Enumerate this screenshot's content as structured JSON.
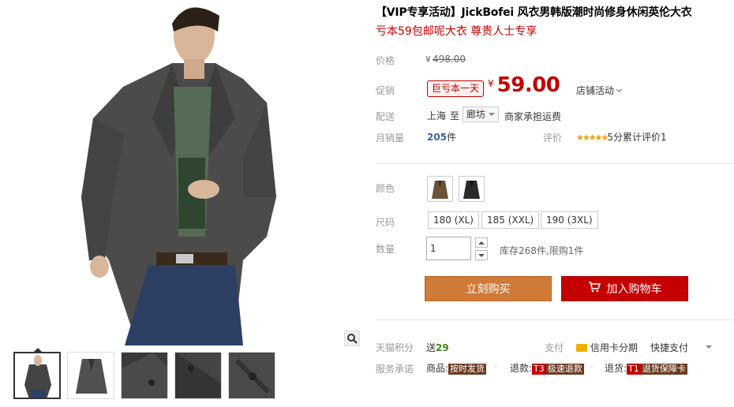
{
  "product": {
    "title": "【VIP专享活动】JickBofei 风衣男韩版潮时尚修身休闲英伦大衣",
    "subtitle": "亏本59包邮呢大衣 尊贵人士专享"
  },
  "price": {
    "label": "价格",
    "currency": "¥",
    "original": "498.00"
  },
  "promo": {
    "label": "促销",
    "tag": "巨亏本一天",
    "currency": "¥",
    "price": "59.00",
    "shop_activity": "店铺活动"
  },
  "shipping": {
    "label": "配送",
    "from": "上海",
    "to_label": "至",
    "destination": "廊坊",
    "fee_note": "商家承担运费"
  },
  "sales": {
    "label": "月销量",
    "count": "205",
    "unit": "件",
    "review_label": "评价",
    "stars": "★★★★★",
    "review_text": "5分累计评价1"
  },
  "color": {
    "label": "颜色",
    "options": [
      "brown-coat",
      "black-coat"
    ]
  },
  "size": {
    "label": "尺码",
    "options": [
      "180 (XL)",
      "185 (XXL)",
      "190 (3XL)"
    ]
  },
  "quantity": {
    "label": "数量",
    "value": "1",
    "stock_text": "库存268件,限购1件"
  },
  "actions": {
    "buy_now": "立刻购买",
    "add_to_cart": "加入购物车"
  },
  "points": {
    "label": "天猫积分",
    "prefix": "送",
    "value": "29",
    "pay_label": "支付",
    "credit": "信用卡分期",
    "quick_pay": "快捷支付"
  },
  "service": {
    "label": "服务承诺",
    "goods_label": "商品:",
    "goods_tag": "按时发货",
    "refund_label": "退款:",
    "refund_tag_prefix": "T3",
    "refund_tag": "极速退款",
    "return_label": "退货:",
    "return_tag_prefix": "T1",
    "return_tag": "退货保障卡"
  },
  "colors": {
    "accent_red": "#c40000",
    "buy_orange": "#d07a38",
    "link_blue": "#336699"
  }
}
